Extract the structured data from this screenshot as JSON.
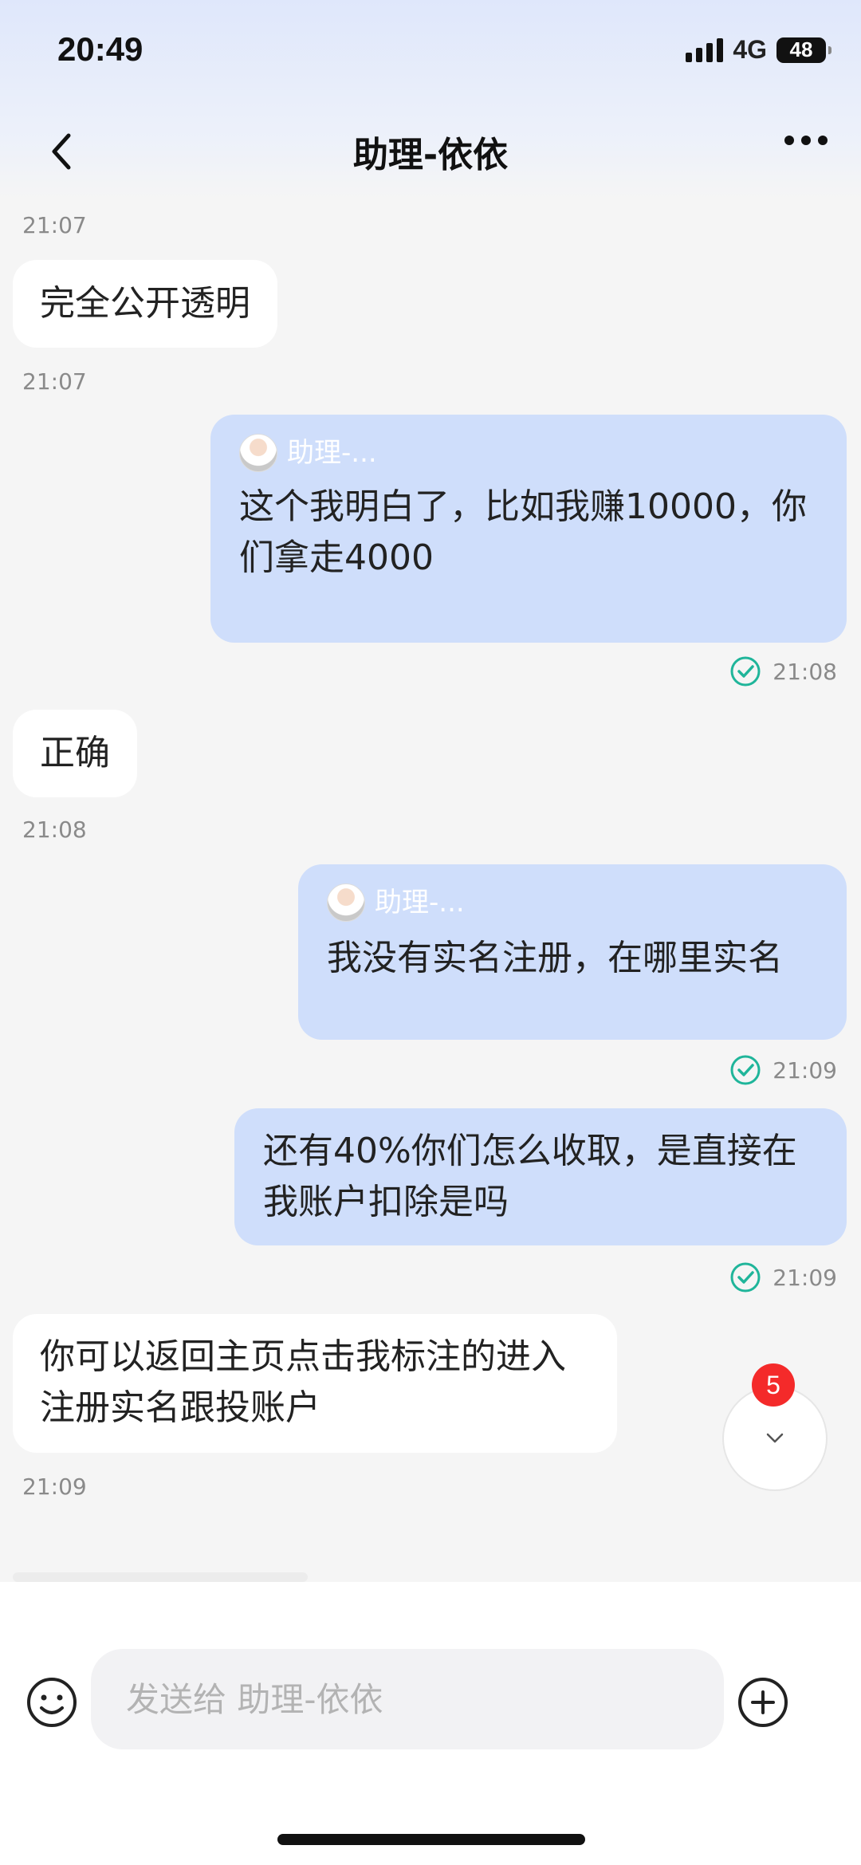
{
  "status_bar": {
    "time": "20:49",
    "network": "4G",
    "battery": "48"
  },
  "header": {
    "title": "助理-依依"
  },
  "messages": [
    {
      "text": "完全公开透明",
      "time": "21:07"
    },
    {
      "quote_name": "助理-...",
      "text": "这个我明白了，比如我赚10000，你们拿走4000",
      "time": "21:08"
    },
    {
      "text": "正确",
      "time": "21:08"
    },
    {
      "quote_name": "助理-...",
      "text": "我没有实名注册，在哪里实名",
      "time": "21:09"
    },
    {
      "text": "还有40%你们怎么收取，是直接在我账户扣除是吗",
      "time": "21:09"
    },
    {
      "text": "你可以返回主页点击我标注的进入注册实名跟投账户",
      "time": "21:09"
    }
  ],
  "top_timestamp": "21:07",
  "scroll_badge": "5",
  "composer": {
    "placeholder": "发送给 助理-依依"
  },
  "colors": {
    "outgoing_bubble": "#cfdefb",
    "incoming_bubble": "#ffffff",
    "read_check": "#1fb59a",
    "badge": "#f42a2a"
  }
}
